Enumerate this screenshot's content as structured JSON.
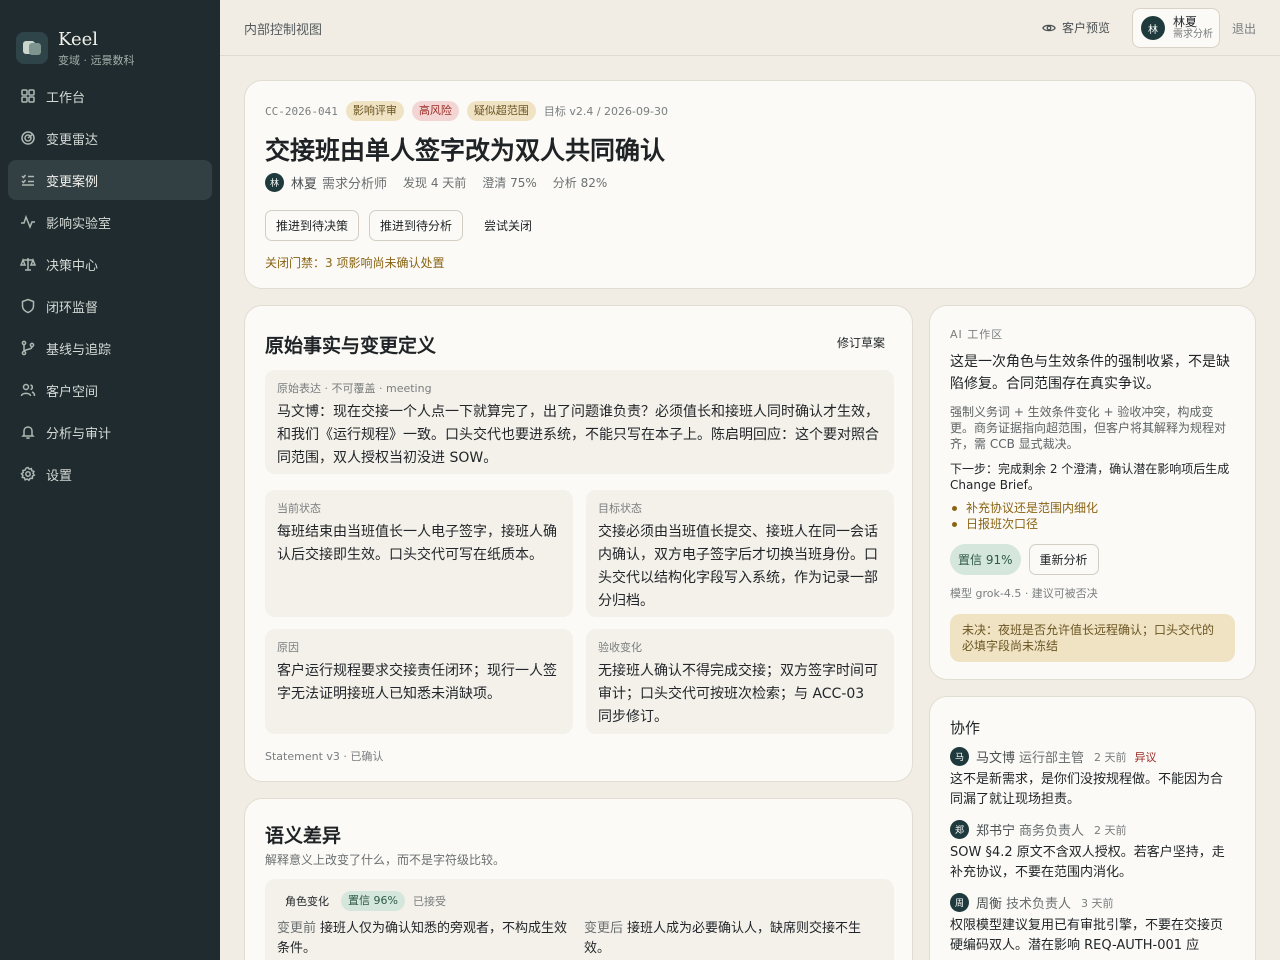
{
  "sidebar": {
    "brand_name": "Keel",
    "brand_sub": "变域 · 远景数科",
    "items": [
      {
        "label": "工作台",
        "icon": "dashboard-icon"
      },
      {
        "label": "变更雷达",
        "icon": "radar-icon"
      },
      {
        "label": "变更案例",
        "icon": "list-check-icon",
        "active": true
      },
      {
        "label": "影响实验室",
        "icon": "activity-icon"
      },
      {
        "label": "决策中心",
        "icon": "scale-icon"
      },
      {
        "label": "闭环监督",
        "icon": "shield-icon"
      },
      {
        "label": "基线与追踪",
        "icon": "git-branch-icon"
      },
      {
        "label": "客户空间",
        "icon": "users-icon"
      },
      {
        "label": "分析与审计",
        "icon": "bell-icon"
      },
      {
        "label": "设置",
        "icon": "gear-icon"
      }
    ]
  },
  "topbar": {
    "title": "内部控制视图",
    "preview_label": "客户预览",
    "user": {
      "initial": "林",
      "name": "林夏",
      "role": "需求分析"
    },
    "logout_label": "退出"
  },
  "case": {
    "id": "CC-2026-041",
    "tags": {
      "review": "影响评审",
      "risk": "高风险",
      "scope": "疑似超范围"
    },
    "target": "目标 v2.4 / 2026-09-30",
    "title": "交接班由单人签字改为双人共同确认",
    "owner": {
      "initial": "林",
      "name": "林夏",
      "role": "需求分析师"
    },
    "discovered": "发现 4 天前",
    "clarify": "澄清 75%",
    "analysis": "分析 82%",
    "buttons": {
      "to_decision": "推进到待决策",
      "to_analysis": "推进到待分析",
      "try_close": "尝试关闭"
    },
    "gate": "关闭门禁：3 项影响尚未确认处置"
  },
  "facts": {
    "title": "原始事实与变更定义",
    "revise_label": "修订草案",
    "original": {
      "label": "原始表达 · 不可覆盖 · meeting",
      "text": "马文博：现在交接一个人点一下就算完了，出了问题谁负责？必须值长和接班人同时确认才生效，和我们《运行规程》一致。口头交代也要进系统，不能只写在本子上。陈启明回应：这个要对照合同范围，双人授权当初没进 SOW。"
    },
    "current": {
      "label": "当前状态",
      "text": "每班结束由当班值长一人电子签字，接班人确认后交接即生效。口头交代可写在纸质本。"
    },
    "target": {
      "label": "目标状态",
      "text": "交接必须由当班值长提交、接班人在同一会话内确认，双方电子签字后才切换当班身份。口头交代以结构化字段写入系统，作为记录一部分归档。"
    },
    "reason": {
      "label": "原因",
      "text": "客户运行规程要求交接责任闭环；现行一人签字无法证明接班人已知悉未消缺项。"
    },
    "acceptance": {
      "label": "验收变化",
      "text": "无接班人确认不得完成交接；双方签字时间可审计；口头交代可按班次检索；与 ACC-03 同步修订。"
    },
    "footer": "Statement v3 · 已确认"
  },
  "diff": {
    "title": "语义差异",
    "subtitle": "解释意义上改变了什么，而不是字符级比较。",
    "kind": "角色变化",
    "confidence": "置信 96%",
    "status": "已接受",
    "before_label": "变更前",
    "before_text": "接班人仅为确认知悉的旁观者，不构成生效条件。",
    "after_label": "变更后",
    "after_text": "接班人成为必要确认人，缺席则交接不生效。"
  },
  "ai": {
    "label": "AI 工作区",
    "headline": "这是一次角色与生效条件的强制收紧，不是缺陷修复。合同范围存在真实争议。",
    "body": "强制义务词 + 生效条件变化 + 验收冲突，构成变更。商务证据指向超范围，但客户将其解释为规程对齐，需 CCB 显式裁决。",
    "next": "下一步：完成剩余 2 个澄清，确认潜在影响项后生成 Change Brief。",
    "items": [
      "补充协议还是范围内细化",
      "日报班次口径"
    ],
    "confidence": "置信 91%",
    "reanalyze_label": "重新分析",
    "model": "模型 grok-4.5 · 建议可被否决",
    "pending": "未决：夜班是否允许值长远程确认；口头交代的必填字段尚未冻结"
  },
  "collab": {
    "title": "协作",
    "comments": [
      {
        "initial": "马",
        "name": "马文博",
        "role": "运行部主管",
        "time": "2 天前",
        "flag": "异议",
        "text": "这不是新需求，是你们没按规程做。不能因为合同漏了就让现场担责。"
      },
      {
        "initial": "郑",
        "name": "郑书宁",
        "role": "商务负责人",
        "time": "2 天前",
        "flag": "",
        "text": "SOW §4.2 原文不含双人授权。若客户坚持，走补充协议，不要在范围内消化。"
      },
      {
        "initial": "周",
        "name": "周衡",
        "role": "技术负责人",
        "time": "3 天前",
        "flag": "",
        "text": "权限模型建议复用已有审批引擎，不要在交接页硬编码双人。潜在影响 REQ-AUTH-001 应"
      }
    ]
  }
}
